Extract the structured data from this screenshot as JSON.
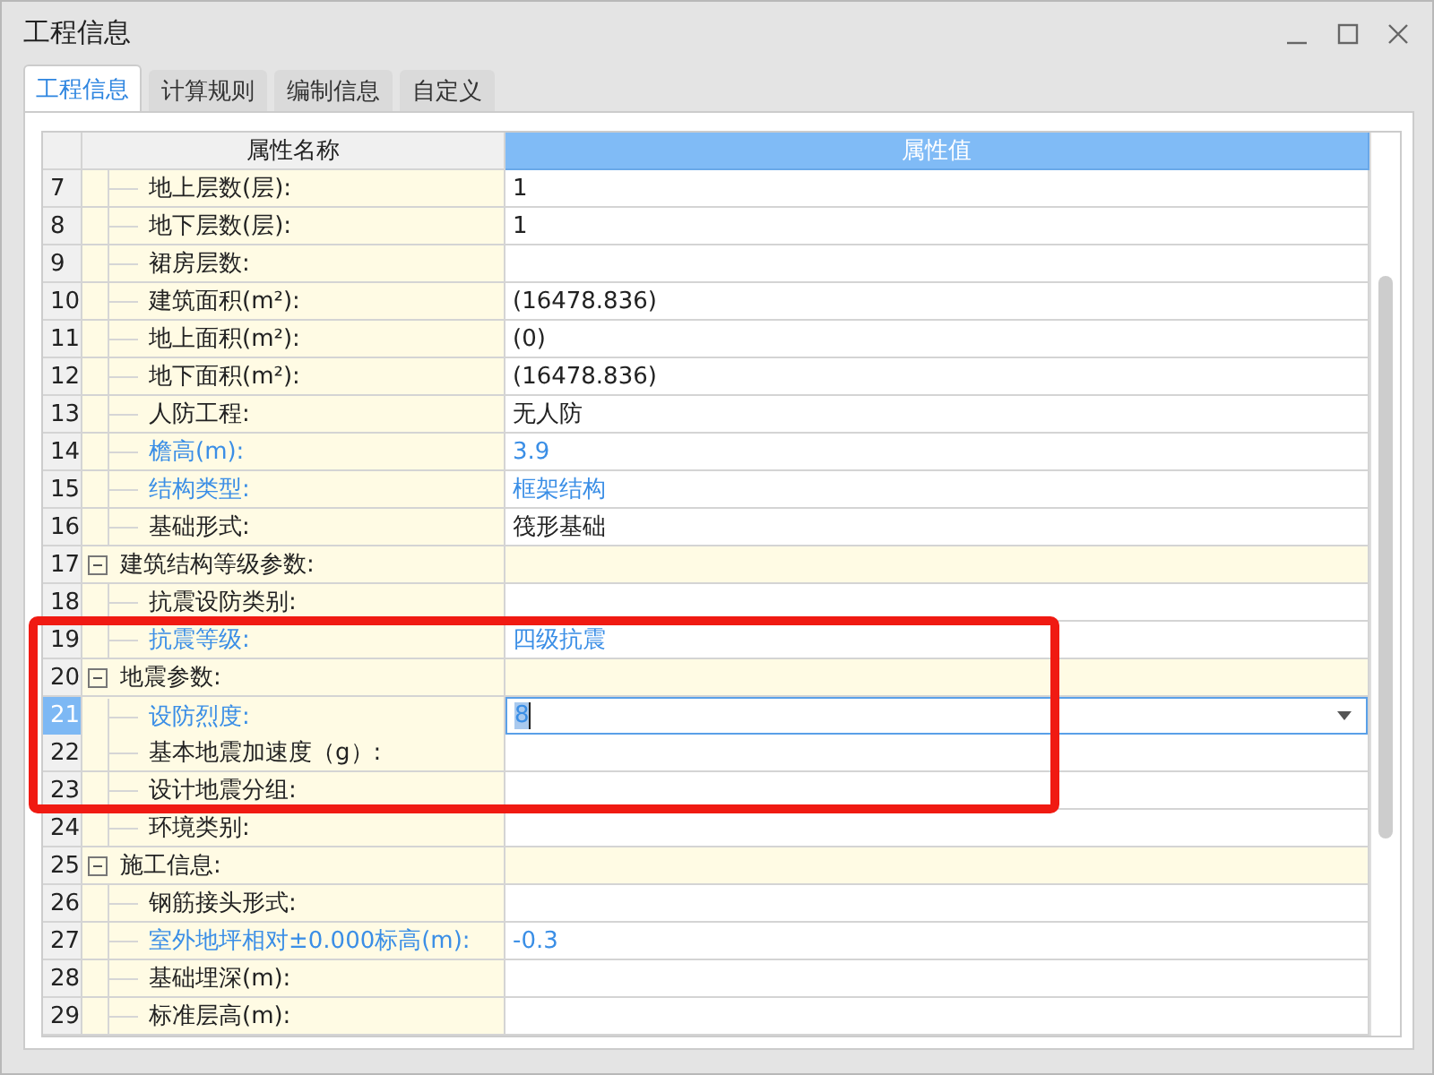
{
  "window": {
    "title": "工程信息"
  },
  "tabs": [
    {
      "label": "工程信息",
      "selected": true
    },
    {
      "label": "计算规则",
      "selected": false
    },
    {
      "label": "编制信息",
      "selected": false
    },
    {
      "label": "自定义",
      "selected": false
    }
  ],
  "grid": {
    "columns": [
      {
        "label": "属性名称",
        "selected": false
      },
      {
        "label": "属性值",
        "selected": true
      }
    ],
    "rows": [
      {
        "number": "7",
        "kind": "item",
        "name": "地上层数(层):",
        "value": "1",
        "highlighted": false,
        "selected": false,
        "annotated": false
      },
      {
        "number": "8",
        "kind": "item",
        "name": "地下层数(层):",
        "value": "1",
        "highlighted": false,
        "selected": false,
        "annotated": false
      },
      {
        "number": "9",
        "kind": "item",
        "name": "裙房层数:",
        "highlighted": false,
        "selected": false,
        "annotated": false
      },
      {
        "number": "10",
        "kind": "item",
        "name": "建筑面积(m²):",
        "value": "(16478.836)",
        "highlighted": false,
        "selected": false,
        "annotated": false
      },
      {
        "number": "11",
        "kind": "item",
        "name": "地上面积(m²):",
        "value": "(0)",
        "highlighted": false,
        "selected": false,
        "annotated": false
      },
      {
        "number": "12",
        "kind": "item",
        "name": "地下面积(m²):",
        "value": "(16478.836)",
        "highlighted": false,
        "selected": false,
        "annotated": false
      },
      {
        "number": "13",
        "kind": "item",
        "name": "人防工程:",
        "value": "无人防",
        "highlighted": false,
        "selected": false,
        "annotated": false
      },
      {
        "number": "14",
        "kind": "item",
        "name": "檐高(m):",
        "value": "3.9",
        "highlighted": true,
        "selected": false,
        "annotated": false
      },
      {
        "number": "15",
        "kind": "item",
        "name": "结构类型:",
        "value": "框架结构",
        "highlighted": true,
        "selected": false,
        "annotated": false
      },
      {
        "number": "16",
        "kind": "item",
        "name": "基础形式:",
        "value": "筏形基础",
        "highlighted": false,
        "selected": false,
        "annotated": false
      },
      {
        "number": "17",
        "kind": "group",
        "name": "建筑结构等级参数:",
        "expanded": true,
        "highlighted": false,
        "selected": false,
        "annotated": false
      },
      {
        "number": "18",
        "kind": "item",
        "name": "抗震设防类别:",
        "highlighted": false,
        "selected": false,
        "annotated": false
      },
      {
        "number": "19",
        "kind": "item",
        "name": "抗震等级:",
        "value": "四级抗震",
        "highlighted": true,
        "selected": false,
        "annotated": true
      },
      {
        "number": "20",
        "kind": "group",
        "name": "地震参数:",
        "expanded": true,
        "highlighted": false,
        "selected": false,
        "annotated": true
      },
      {
        "number": "21",
        "kind": "item",
        "name": "设防烈度:",
        "value": "8",
        "highlighted": true,
        "selected": true,
        "annotated": true
      },
      {
        "number": "22",
        "kind": "item",
        "name": "基本地震加速度（g）:",
        "highlighted": false,
        "selected": false,
        "annotated": true
      },
      {
        "number": "23",
        "kind": "item",
        "name": "设计地震分组:",
        "highlighted": false,
        "selected": false,
        "annotated": true
      },
      {
        "number": "24",
        "kind": "item",
        "name": "环境类别:",
        "highlighted": false,
        "selected": false,
        "annotated": false
      },
      {
        "number": "25",
        "kind": "group",
        "name": "施工信息:",
        "expanded": true,
        "highlighted": false,
        "selected": false,
        "annotated": false
      },
      {
        "number": "26",
        "kind": "item",
        "name": "钢筋接头形式:",
        "highlighted": false,
        "selected": false,
        "annotated": false
      },
      {
        "number": "27",
        "kind": "item",
        "name": "室外地坪相对±0.000标高(m):",
        "value": "-0.3",
        "highlighted": true,
        "selected": false,
        "annotated": false
      },
      {
        "number": "28",
        "kind": "item",
        "name": "基础埋深(m):",
        "highlighted": false,
        "selected": false,
        "annotated": false
      },
      {
        "number": "29",
        "kind": "item",
        "name": "标准层高(m):",
        "highlighted": false,
        "selected": false,
        "annotated": false
      }
    ]
  }
}
